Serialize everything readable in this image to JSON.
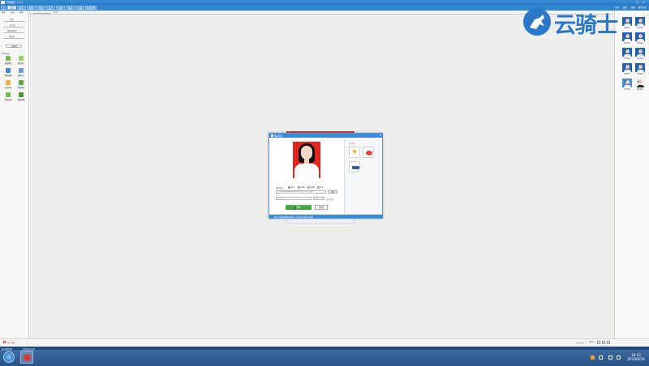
{
  "titlebar": {
    "title": "智能照片 6.0.1"
  },
  "tabs": [
    {
      "label": "首页"
    },
    {
      "label": "照片"
    },
    {
      "label": "模版"
    },
    {
      "label": "排版"
    },
    {
      "label": "文字"
    },
    {
      "label": "边框"
    },
    {
      "label": "特效"
    },
    {
      "label": "有趣"
    },
    {
      "label": "批量处理"
    }
  ],
  "top_right_links": [
    "登录",
    "设置",
    "帮助",
    "版本升级"
  ],
  "sidebar": {
    "subtabs": [
      "精修",
      "美容",
      "调色"
    ],
    "adjust_labels": [
      "亮度",
      "对比度",
      "自然饱和度",
      "饱和度"
    ],
    "reset_button": "一键美化",
    "tools_header": "常用功能",
    "tools": [
      {
        "label": "抠图换底",
        "color": "#7ab648"
      },
      {
        "label": "裁剪照片",
        "color": "#9ad06b"
      },
      {
        "label": "智能抠图",
        "color": "#3a88d6"
      },
      {
        "label": "调整尺寸",
        "color": "#6aa0d8"
      },
      {
        "label": "去除背景",
        "color": "#e8b23a"
      },
      {
        "label": "智能修复",
        "color": "#5aa840"
      },
      {
        "label": "批量修图",
        "color": "#6cc04a"
      },
      {
        "label": "换装抠图",
        "color": "#4a9a3a"
      }
    ]
  },
  "thumbnails": [
    {
      "caption": "证件照1"
    },
    {
      "caption": "证件照2"
    },
    {
      "caption": "证件照3"
    },
    {
      "caption": "证件照4"
    },
    {
      "caption": "证件照5"
    },
    {
      "caption": "证件照6"
    },
    {
      "caption": "证件照7"
    },
    {
      "caption": "证件照8"
    },
    {
      "caption": "证件照9"
    },
    {
      "caption": "证件照10"
    }
  ],
  "watermark": {
    "text": "云骑士"
  },
  "dialog": {
    "title": "保存照片",
    "format_label": "保存格式",
    "format_options": [
      "JPG",
      "PNG",
      "BMP",
      "GIF"
    ],
    "path_value": "C:\\Users\\Administrator\\Pictures\\证件照.jpg",
    "browse_button": "浏览",
    "filename_value": "证件照1",
    "quality_value": "100",
    "quality_label": "图片质量",
    "primary_button": "保存",
    "cancel_button": "取消",
    "share_title": "分享到：",
    "share_items": [
      {
        "name": "收藏",
        "color": "#f0b21e"
      },
      {
        "name": "微博",
        "color": "#e0443a"
      },
      {
        "name": "人人",
        "color": "#2e5fa8"
      }
    ],
    "status_text": "照片已经保存到指定路径，可在指定文件夹中查看"
  },
  "statusbar": {
    "left_text": "显示原图",
    "zoom_text": "100%"
  },
  "taskbar": {
    "notif_left": "照片处理完成",
    "notif_mid": "打开所在文件夹",
    "time": "16:52",
    "date": "2019/6/28"
  }
}
